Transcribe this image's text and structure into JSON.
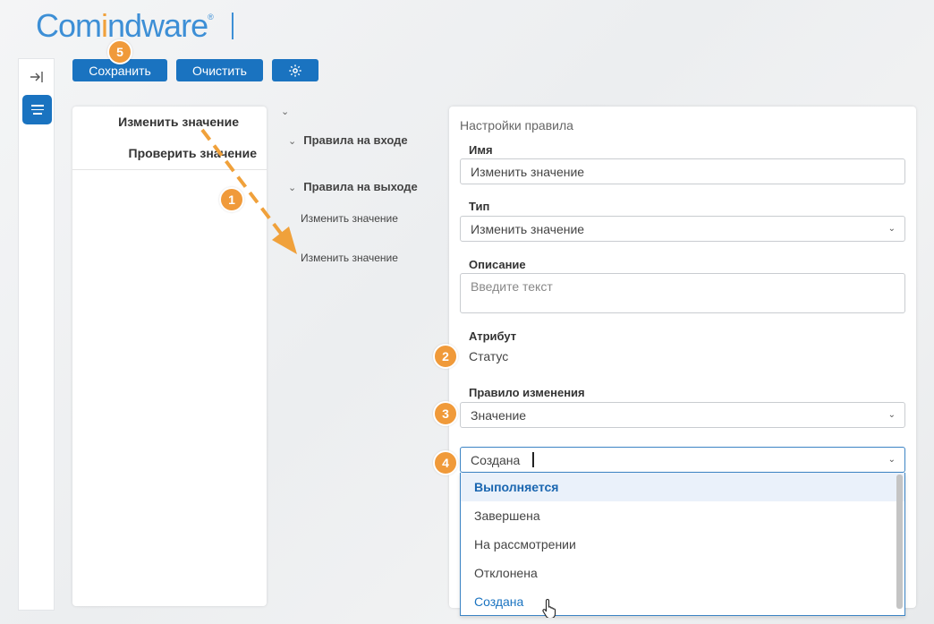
{
  "logo": {
    "part1": "Com",
    "part2": "i",
    "part3": "ndware",
    "reg": "®"
  },
  "toolbar": {
    "save_label": "Сохранить",
    "clear_label": "Очистить"
  },
  "left_panel": {
    "items": [
      "Изменить значение",
      "Проверить значение"
    ]
  },
  "tree": {
    "groups": [
      {
        "label": "Правила на входе"
      },
      {
        "label": "Правила на выходе"
      }
    ],
    "leaves": [
      "Изменить значение",
      "Изменить значение"
    ]
  },
  "rule_settings": {
    "title": "Настройки правила",
    "name_label": "Имя",
    "name_value": "Изменить значение",
    "type_label": "Тип",
    "type_value": "Изменить значение",
    "description_label": "Описание",
    "description_placeholder": "Введите текст",
    "attribute_label": "Атрибут",
    "attribute_value": "Статус",
    "change_rule_label": "Правило изменения",
    "change_rule_value": "Значение",
    "value_input": "Создана",
    "dropdown_options": [
      "Выполняется",
      "Завершена",
      "На рассмотрении",
      "Отклонена",
      "Создана"
    ]
  },
  "badges": [
    "1",
    "2",
    "3",
    "4",
    "5"
  ],
  "colors": {
    "accent": "#1a73c0",
    "badge": "#f09a3a",
    "logo_blue": "#3d8fd6",
    "logo_orange": "#f0a13b"
  }
}
